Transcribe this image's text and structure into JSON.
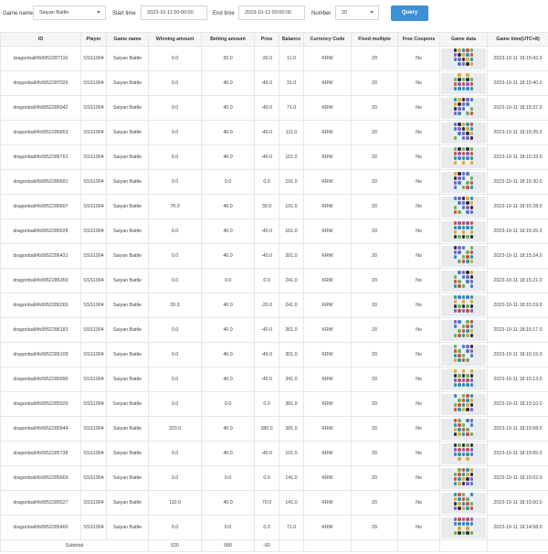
{
  "filters": {
    "game_name_label": "Game name",
    "game_name_value": "Saiyan Battle",
    "start_time_label": "Start time",
    "start_time_value": "2023-10-11 00:00:00",
    "end_time_label": "End time",
    "end_time_value": "2023-10-12 00:00:00",
    "number_label": "Number",
    "number_value": "20",
    "query_label": "Query"
  },
  "colors": {
    "accent": "#3d8fd6",
    "header_bg": "#f4f6f8",
    "border": "#e4e7ea",
    "gamedata_bg": "#e7ebee"
  },
  "table": {
    "headers": [
      "ID",
      "Player",
      "Game name",
      "Winning amount",
      "Betting amount",
      "Prize",
      "Balance",
      "Currency Code",
      "Fixed multiple",
      "Free Coupons",
      "Game data",
      "Game time(UTC+8)"
    ],
    "rows": [
      [
        "dragonball#b9952287110",
        "SSS1004",
        "Saiyan Battle",
        "0.0",
        "20.0",
        "-20.0",
        "11.0",
        "KRW",
        "20",
        "No",
        "2023-10-11 18:15:42.0"
      ],
      [
        "dragonball#b9952287026",
        "SSS1004",
        "Saiyan Battle",
        "0.0",
        "40.0",
        "-40.0",
        "31.0",
        "KRW",
        "20",
        "No",
        "2023-10-11 18:15:40.0"
      ],
      [
        "dragonball#b9952286942",
        "SSS1004",
        "Saiyan Battle",
        "0.0",
        "40.0",
        "-40.0",
        "71.0",
        "KRW",
        "20",
        "No",
        "2023-10-11 18:15:37.0"
      ],
      [
        "dragonball#b9952286853",
        "SSS1004",
        "Saiyan Battle",
        "0.0",
        "40.0",
        "-40.0",
        "111.0",
        "KRW",
        "20",
        "No",
        "2023-10-11 18:15:35.0"
      ],
      [
        "dragonball#b9952286761",
        "SSS1004",
        "Saiyan Battle",
        "0.0",
        "40.0",
        "-40.0",
        "151.0",
        "KRW",
        "20",
        "No",
        "2023-10-11 18:15:33.0"
      ],
      [
        "dragonball#b9952286691",
        "SSS1004",
        "Saiyan Battle",
        "0.0",
        "0.0",
        "0.0",
        "191.0",
        "KRW",
        "20",
        "No",
        "2023-10-11 18:15:30.0"
      ],
      [
        "dragonball#b9952286607",
        "SSS1004",
        "Saiyan Battle",
        "70.0",
        "40.0",
        "30.0",
        "191.0",
        "KRW",
        "20",
        "No",
        "2023-10-11 18:15:28.0"
      ],
      [
        "dragonball#b9952286528",
        "SSS1004",
        "Saiyan Battle",
        "0.0",
        "40.0",
        "-40.0",
        "161.0",
        "KRW",
        "20",
        "No",
        "2023-10-11 18:15:26.0"
      ],
      [
        "dragonball#b9952286431",
        "SSS1004",
        "Saiyan Battle",
        "0.0",
        "40.0",
        "-40.0",
        "201.0",
        "KRW",
        "20",
        "No",
        "2023-10-11 18:15:24.0"
      ],
      [
        "dragonball#b9952286359",
        "SSS1004",
        "Saiyan Battle",
        "0.0",
        "0.0",
        "0.0",
        "241.0",
        "KRW",
        "20",
        "No",
        "2023-10-11 18:15:21.0"
      ],
      [
        "dragonball#b9952286269",
        "SSS1004",
        "Saiyan Battle",
        "20.0",
        "40.0",
        "-20.0",
        "241.0",
        "KRW",
        "20",
        "No",
        "2023-10-11 18:15:19.0"
      ],
      [
        "dragonball#b9952286183",
        "SSS1004",
        "Saiyan Battle",
        "0.0",
        "40.0",
        "-40.0",
        "261.0",
        "KRW",
        "20",
        "No",
        "2023-10-11 18:15:17.0"
      ],
      [
        "dragonball#b9952286109",
        "SSS1004",
        "Saiyan Battle",
        "0.0",
        "40.0",
        "-40.0",
        "301.0",
        "KRW",
        "20",
        "No",
        "2023-10-11 18:15:15.0"
      ],
      [
        "dragonball#b9952285990",
        "SSS1004",
        "Saiyan Battle",
        "0.0",
        "40.0",
        "-40.0",
        "341.0",
        "KRW",
        "20",
        "No",
        "2023-10-11 18:15:13.0"
      ],
      [
        "dragonball#b9952285920",
        "SSS1004",
        "Saiyan Battle",
        "0.0",
        "0.0",
        "0.0",
        "381.0",
        "KRW",
        "20",
        "No",
        "2023-10-11 18:15:10.0"
      ],
      [
        "dragonball#b9952285844",
        "SSS1004",
        "Saiyan Battle",
        "320.0",
        "40.0",
        "280.0",
        "381.0",
        "KRW",
        "20",
        "No",
        "2023-10-11 18:15:08.0"
      ],
      [
        "dragonball#b9952285738",
        "SSS1004",
        "Saiyan Battle",
        "0.0",
        "40.0",
        "-40.0",
        "101.0",
        "KRW",
        "20",
        "No",
        "2023-10-11 18:15:05.0"
      ],
      [
        "dragonball#b9952285669",
        "SSS1004",
        "Saiyan Battle",
        "0.0",
        "0.0",
        "0.0",
        "141.0",
        "KRW",
        "20",
        "No",
        "2023-10-11 18:15:02.0"
      ],
      [
        "dragonball#b9952285527",
        "SSS1004",
        "Saiyan Battle",
        "110.0",
        "40.0",
        "70.0",
        "141.0",
        "KRW",
        "20",
        "No",
        "2023-10-11 18:15:00.0"
      ],
      [
        "dragonball#b9952285460",
        "SSS1004",
        "Saiyan Battle",
        "0.0",
        "0.0",
        "0.0",
        "71.0",
        "KRW",
        "20",
        "No",
        "2023-10-11 18:14:58.0"
      ]
    ],
    "game_data_icon": "symbol-grid-icon",
    "subtotal": {
      "label": "Subtotal",
      "winning": "520",
      "betting": "580",
      "prize": "-60"
    }
  }
}
